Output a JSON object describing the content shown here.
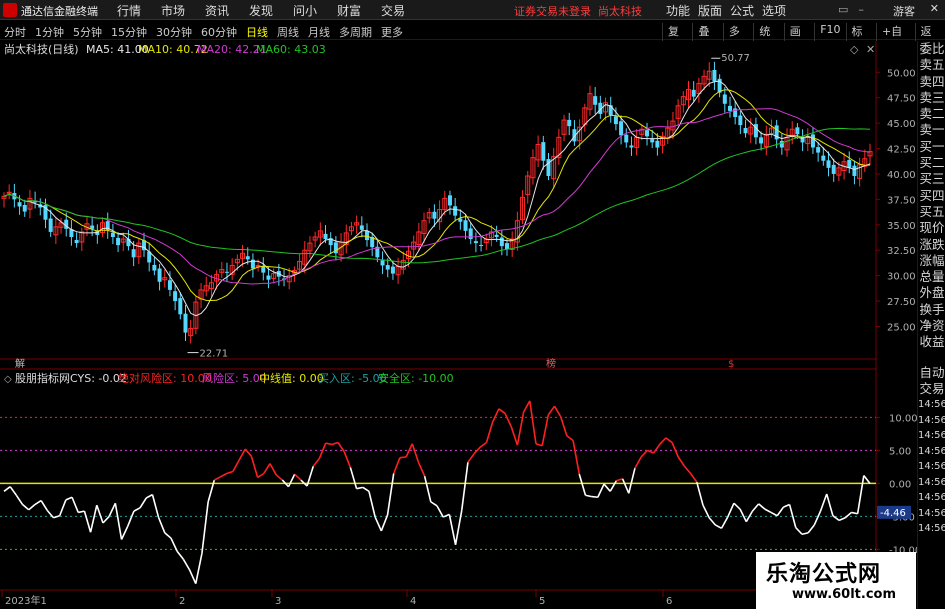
{
  "menubar": {
    "app_name": "通达信金融终端",
    "menus": [
      "行情",
      "市场",
      "资讯",
      "发现",
      "问小达",
      "财富圈",
      "交易"
    ],
    "notice": "证券交易未登录",
    "stock_name_top": "尚太科技",
    "right_menus": [
      "功能",
      "版面",
      "公式",
      "选项"
    ],
    "guest": "游客",
    "close": "✕"
  },
  "periodbar": {
    "tabs": [
      "分时",
      "1分钟",
      "5分钟",
      "15分钟",
      "30分钟",
      "60分钟",
      "日线",
      "周线",
      "月线",
      "多周期",
      "更多"
    ],
    "active_tab": "日线",
    "tools": [
      "复权",
      "叠加",
      "多股",
      "统计",
      "画线",
      "F10",
      "标记",
      "+自选",
      "返回"
    ]
  },
  "main_panel": {
    "title": "尚太科技(日线)",
    "ma": [
      {
        "label": "MA5: 41.00",
        "color": "#e6e6e6"
      },
      {
        "label": "MA10: 40.72",
        "color": "#e6e600"
      },
      {
        "label": "MA20: 42.21",
        "color": "#d13ad1"
      },
      {
        "label": "MA60: 43.03",
        "color": "#22c322"
      }
    ],
    "high_label": "50.77",
    "low_label": "22.71",
    "markers": [
      {
        "text": "解",
        "color": "#bbbbbb"
      },
      {
        "text": "榜",
        "color": "#dd6666"
      },
      {
        "text": "$",
        "color": "#dd3333"
      }
    ],
    "price_ticks": [
      "50.00",
      "47.50",
      "45.00",
      "42.50",
      "40.00",
      "37.50",
      "35.00",
      "32.50",
      "30.00",
      "27.50",
      "25.00"
    ]
  },
  "indicator_panel": {
    "title": "股朋指标网",
    "cys": "CYS: -0.02",
    "params": [
      {
        "label": "绝对风险区: 10.00",
        "color": "#ff2020"
      },
      {
        "label": "风险区: 5.00",
        "color": "#d13ad1"
      },
      {
        "label": "中线值: 0.00",
        "color": "#e6e600"
      },
      {
        "label": "买入区: -5.00",
        "color": "#20a0a0"
      },
      {
        "label": "安全区: -10.00",
        "color": "#22c322"
      }
    ],
    "ticks": [
      "10.00",
      "5.00",
      "0.00",
      "-5.00",
      "-10.00"
    ],
    "current_value": "-4.46"
  },
  "time_axis": {
    "labels": [
      "2023年1",
      "2",
      "3",
      "4",
      "5",
      "6"
    ]
  },
  "right_panel": {
    "labels": [
      "委比",
      "卖五",
      "卖四",
      "卖三",
      "卖二",
      "卖一",
      "买一",
      "买二",
      "买三",
      "买四",
      "买五",
      "现价",
      "涨跌",
      "涨幅",
      "总量",
      "外盘",
      "换手",
      "净资",
      "收益",
      "自动",
      "交易",
      "14:56",
      "14:56",
      "14:56",
      "14:56",
      "14:56",
      "14:56",
      "14:56",
      "14:56",
      "14:56"
    ]
  },
  "watermark": {
    "title": "乐淘公式网",
    "url": "www.60lt.com"
  },
  "chart_data": [
    {
      "type": "candlestick",
      "title": "尚太科技(日线)",
      "ylim": [
        22,
        51.5
      ],
      "grid": false,
      "up_color": "#ff2a2a",
      "down_color": "#54d8ff",
      "closes": [
        37.8,
        38.2,
        37.5,
        36.8,
        36.3,
        37.6,
        37.2,
        36.7,
        35.5,
        34.3,
        34.8,
        35.2,
        34.6,
        33.8,
        33.2,
        34.3,
        35.1,
        34.6,
        34.0,
        35.2,
        34.5,
        33.8,
        33.0,
        33.6,
        32.9,
        31.8,
        33.2,
        32.5,
        31.3,
        30.5,
        29.4,
        29.8,
        28.6,
        27.5,
        26.2,
        24.4,
        24.8,
        27.4,
        28.6,
        29.0,
        29.3,
        30.1,
        30.6,
        30.3,
        31.0,
        31.6,
        32.2,
        31.6,
        30.7,
        31.0,
        30.3,
        29.6,
        30.2,
        29.9,
        29.6,
        30.0,
        30.5,
        31.4,
        32.5,
        33.2,
        33.8,
        34.4,
        33.6,
        33.0,
        32.2,
        33.3,
        34.2,
        34.8,
        35.2,
        34.5,
        33.5,
        32.8,
        31.8,
        31.0,
        30.6,
        30.2,
        30.9,
        31.5,
        32.4,
        33.3,
        34.3,
        35.4,
        36.2,
        35.6,
        36.5,
        37.6,
        36.9,
        35.9,
        35.3,
        34.4,
        33.6,
        33.2,
        33.0,
        33.6,
        34.3,
        33.8,
        32.9,
        32.6,
        33.6,
        35.4,
        37.7,
        39.8,
        41.6,
        42.9,
        41.3,
        39.8,
        41.7,
        43.6,
        45.3,
        44.7,
        43.2,
        44.6,
        46.5,
        47.9,
        46.8,
        45.9,
        47.0,
        45.8,
        44.9,
        43.8,
        43.1,
        42.6,
        43.6,
        44.4,
        43.7,
        43.1,
        42.6,
        43.7,
        44.5,
        45.2,
        46.7,
        47.6,
        48.3,
        47.6,
        48.9,
        49.6,
        50.1,
        49.1,
        48.0,
        46.9,
        46.2,
        45.6,
        44.8,
        44.0,
        44.6,
        43.6,
        43.0,
        43.9,
        44.5,
        43.4,
        42.6,
        43.6,
        44.4,
        43.9,
        43.1,
        43.6,
        42.6,
        42.1,
        41.3,
        40.6,
        40.0,
        40.6,
        41.2,
        40.6,
        39.8,
        40.9,
        41.5,
        42.2
      ]
    },
    {
      "type": "line",
      "title": "股朋指标网",
      "ylim": [
        -16,
        14
      ],
      "series": [
        {
          "name": "CYS",
          "color": "#ffffff",
          "values": [
            -1.2,
            -0.5,
            -1.8,
            -3.2,
            -4.0,
            -3.2,
            -2.6,
            -4.1,
            -5.2,
            -4.9,
            -2.5,
            -2.1,
            -4.4,
            -4.2,
            -7.4,
            -3.3,
            -6.0,
            -5.0,
            -3.0,
            -8.5,
            -6.5,
            -4.2,
            -3.7,
            -2.2,
            -1.7,
            -5.2,
            -7.5,
            -8.3,
            -10.3,
            -11.5,
            -13.1,
            -15.2,
            -10.6,
            -2.8,
            0.5,
            1.0,
            1.5,
            1.8,
            3.5,
            5.2,
            4.1,
            0.9,
            1.5,
            3.0,
            1.3,
            0.5,
            -0.5,
            1.4,
            0.5,
            -0.4,
            2.6,
            3.8,
            6.1,
            5.9,
            6.2,
            4.8,
            2.4,
            -0.8,
            -0.6,
            -1.2,
            -5.1,
            -7.2,
            -4.8,
            1.5,
            3.9,
            4.0,
            6.0,
            3.2,
            1.1,
            -2.8,
            -3.4,
            -5.1,
            -4.7,
            -9.3,
            -4.1,
            3.2,
            4.5,
            5.5,
            6.2,
            9.3,
            11.3,
            10.6,
            8.6,
            5.8,
            10.8,
            12.5,
            6.0,
            5.7,
            10.4,
            11.7,
            10.1,
            7.2,
            6.5,
            1.4,
            -1.8,
            -2.0,
            -2.1,
            -0.1,
            -1.2,
            0.4,
            0.7,
            -1.5,
            2.3,
            4.0,
            5.0,
            4.6,
            5.9,
            6.9,
            6.2,
            4.0,
            2.6,
            1.5,
            0.2,
            -3.3,
            -5.2,
            -6.3,
            -6.8,
            -5.1,
            -3.0,
            -3.9,
            -5.8,
            -4.2,
            -3.1,
            -3.9,
            -4.4,
            -4.9,
            -3.6,
            -3.2,
            -6.7,
            -7.7,
            -7.5,
            -6.3,
            -4.2,
            -1.6,
            -4.9,
            -5.6,
            -5.2,
            -4.4,
            -4.6,
            1.2,
            -0.02
          ]
        },
        {
          "name": "绝对风险区",
          "color": "#ff2020",
          "values": [
            10.0
          ]
        },
        {
          "name": "风险区",
          "color": "#d13ad1",
          "values": [
            5.0
          ]
        },
        {
          "name": "中线值",
          "color": "#e6e600",
          "values": [
            0.0
          ]
        },
        {
          "name": "买入区",
          "color": "#20a0a0",
          "values": [
            -5.0
          ]
        },
        {
          "name": "安全区",
          "color": "#22c322",
          "values": [
            -10.0
          ]
        }
      ]
    }
  ]
}
